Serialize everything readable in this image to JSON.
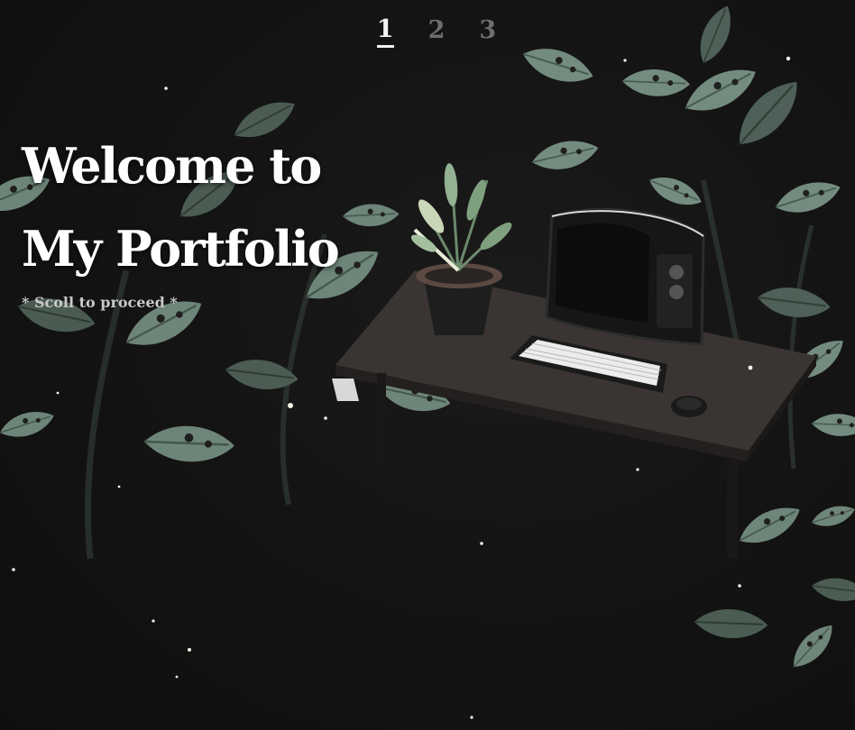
{
  "nav": {
    "items": [
      {
        "label": "1",
        "active": true
      },
      {
        "label": "2",
        "active": false
      },
      {
        "label": "3",
        "active": false
      }
    ]
  },
  "hero": {
    "title_line1": "Welcome to",
    "title_line2": "My Portfolio",
    "subtitle": "* Scoll to proceed *"
  },
  "scene": {
    "background_color": "#121212",
    "leaf_color": "#7f9a8c",
    "desk_color": "#3a3533",
    "keyboard_color": "#eeeeee",
    "icon_names": [
      "monstera-plant-icon",
      "potted-fern-icon",
      "retro-tv-monitor-icon",
      "keyboard-icon",
      "mouse-icon",
      "firefly-icon"
    ]
  }
}
